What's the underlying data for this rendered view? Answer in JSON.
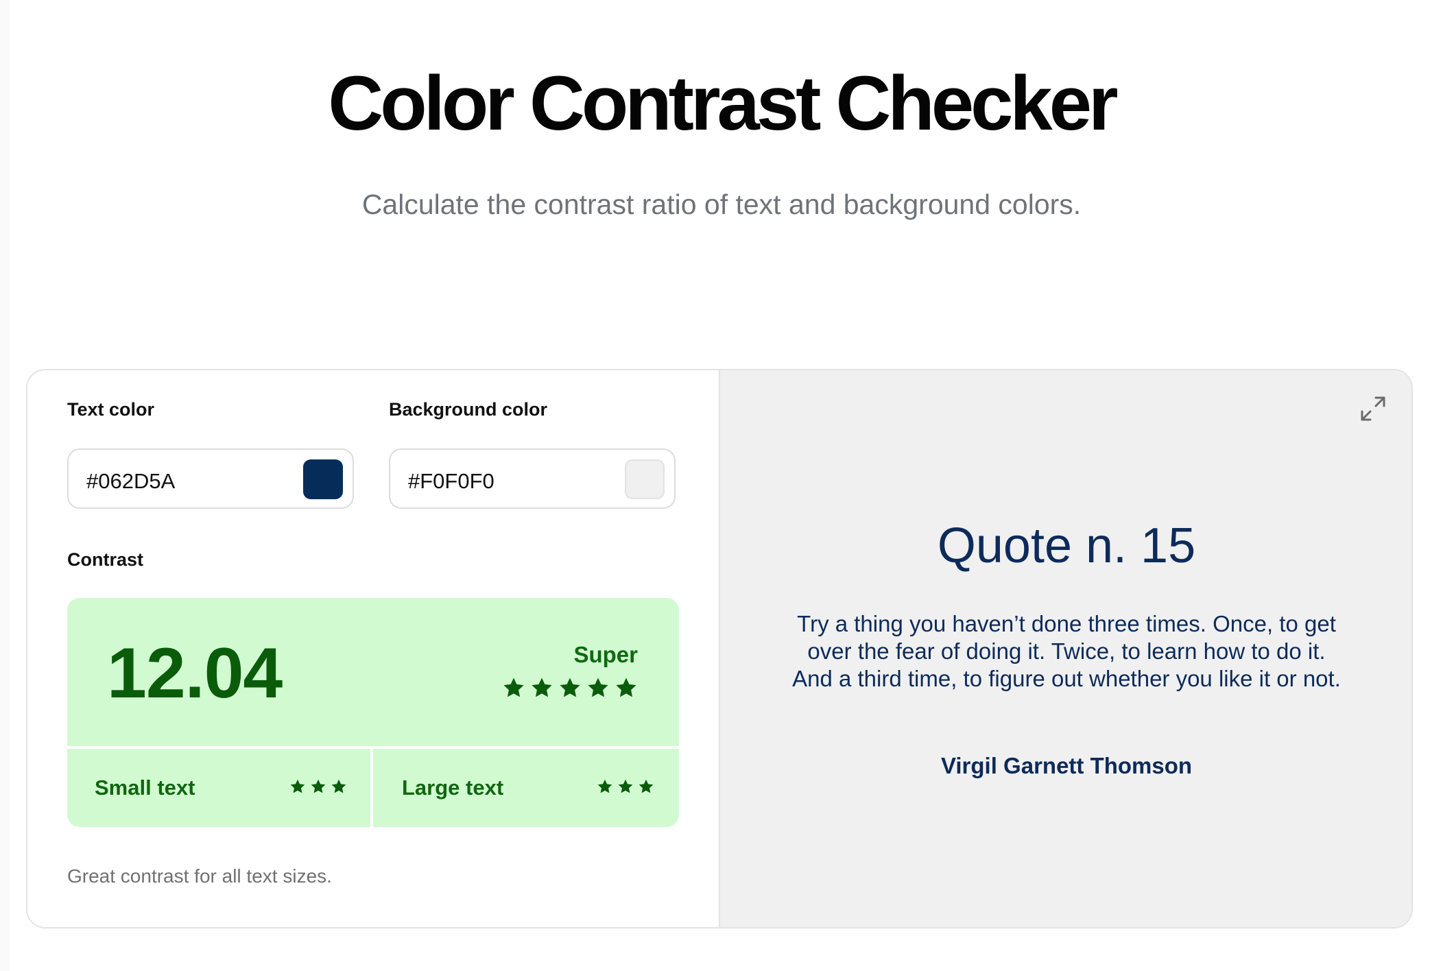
{
  "header": {
    "title": "Color Contrast Checker",
    "subtitle": "Calculate the contrast ratio of text and background colors."
  },
  "inputs": {
    "text_color_label": "Text color",
    "text_color_value": "#062D5A",
    "background_color_label": "Background color",
    "background_color_value": "#F0F0F0"
  },
  "contrast": {
    "label": "Contrast",
    "ratio": "12.04",
    "rating": "Super",
    "rating_stars": 5,
    "small_text_label": "Small text",
    "small_text_stars": 3,
    "large_text_label": "Large text",
    "large_text_stars": 3,
    "note": "Great contrast for all text sizes."
  },
  "preview": {
    "quote_title": "Quote n. 15",
    "quote_text": "Try a thing you haven’t done three times. Once, to get over the fear of doing it. Twice, to learn how to do it. And a third time, to figure out whether you like it or not.",
    "quote_author": "Virgil Garnett Thomson",
    "expand_icon": "expand-icon"
  },
  "colors": {
    "text": "#062D5A",
    "background": "#F0F0F0",
    "contrast_bg": "#D1FAD1",
    "contrast_fg": "#0A5C0A"
  }
}
